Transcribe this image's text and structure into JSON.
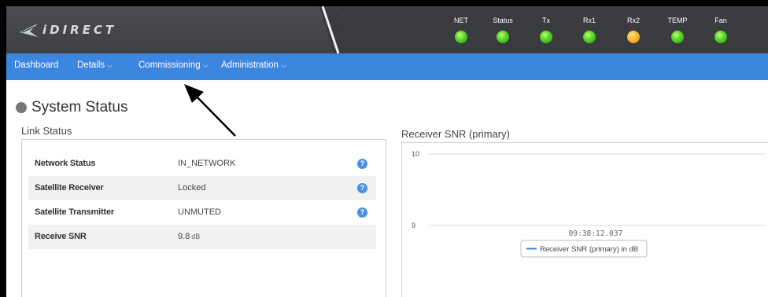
{
  "brand": {
    "logo_text": "iDIRECT"
  },
  "leds": [
    {
      "label": "NET",
      "color": "green"
    },
    {
      "label": "Status",
      "color": "green"
    },
    {
      "label": "Tx",
      "color": "green"
    },
    {
      "label": "Rx1",
      "color": "green"
    },
    {
      "label": "Rx2",
      "color": "amber"
    },
    {
      "label": "TEMP",
      "color": "green"
    },
    {
      "label": "Fan",
      "color": "green"
    }
  ],
  "nav": {
    "dashboard": "Dashboard",
    "details": "Details",
    "commissioning": "Commissioning",
    "administration": "Administration"
  },
  "page": {
    "title": "System Status"
  },
  "link_status": {
    "title": "Link Status",
    "rows": [
      {
        "label": "Network Status",
        "value": "IN_NETWORK",
        "unit": ""
      },
      {
        "label": "Satellite Receiver",
        "value": "Locked",
        "unit": ""
      },
      {
        "label": "Satellite Transmitter",
        "value": "UNMUTED",
        "unit": ""
      },
      {
        "label": "Receive SNR",
        "value": "9.8",
        "unit": "dB"
      }
    ],
    "help_glyph": "?"
  },
  "snr_panel": {
    "title": "Receiver SNR (primary)"
  },
  "chart_data": {
    "type": "line",
    "y_ticks": [
      "10",
      "9"
    ],
    "ylim": [
      9,
      10
    ],
    "x_tick_label": "09:38:12.037",
    "series": [
      {
        "name": "Receiver SNR (primary) in dB",
        "color": "#3d86e0",
        "values": []
      }
    ],
    "legend_position": "bottom-center",
    "grid": true
  }
}
